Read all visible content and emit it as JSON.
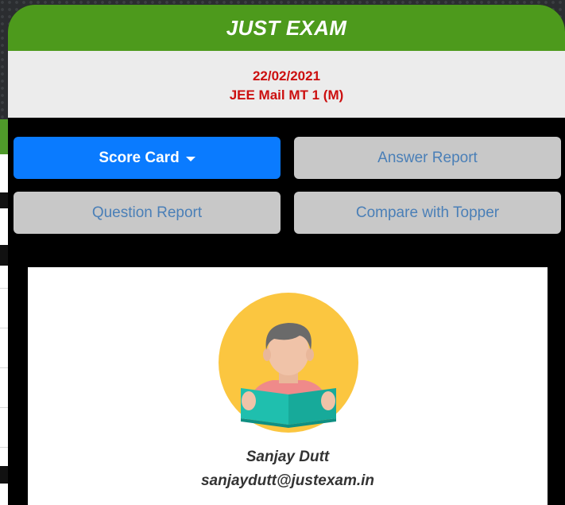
{
  "modal": {
    "title": "JUST EXAM",
    "exam_date": "22/02/2021",
    "exam_name": "JEE Mail MT 1 (M)"
  },
  "buttons": {
    "score_card": "Score Card",
    "answer_report": "Answer Report",
    "question_report": "Question Report",
    "compare_with_topper": "Compare with Topper"
  },
  "profile": {
    "avatar_icon": "student-reading-avatar-icon",
    "name": "Sanjay Dutt",
    "email": "sanjaydutt@justexam.in"
  },
  "colors": {
    "header_green": "#4d9a1c",
    "exam_text_red": "#cc0f0f",
    "primary_blue": "#0a7bff",
    "secondary_gray": "#c8c8c8"
  }
}
